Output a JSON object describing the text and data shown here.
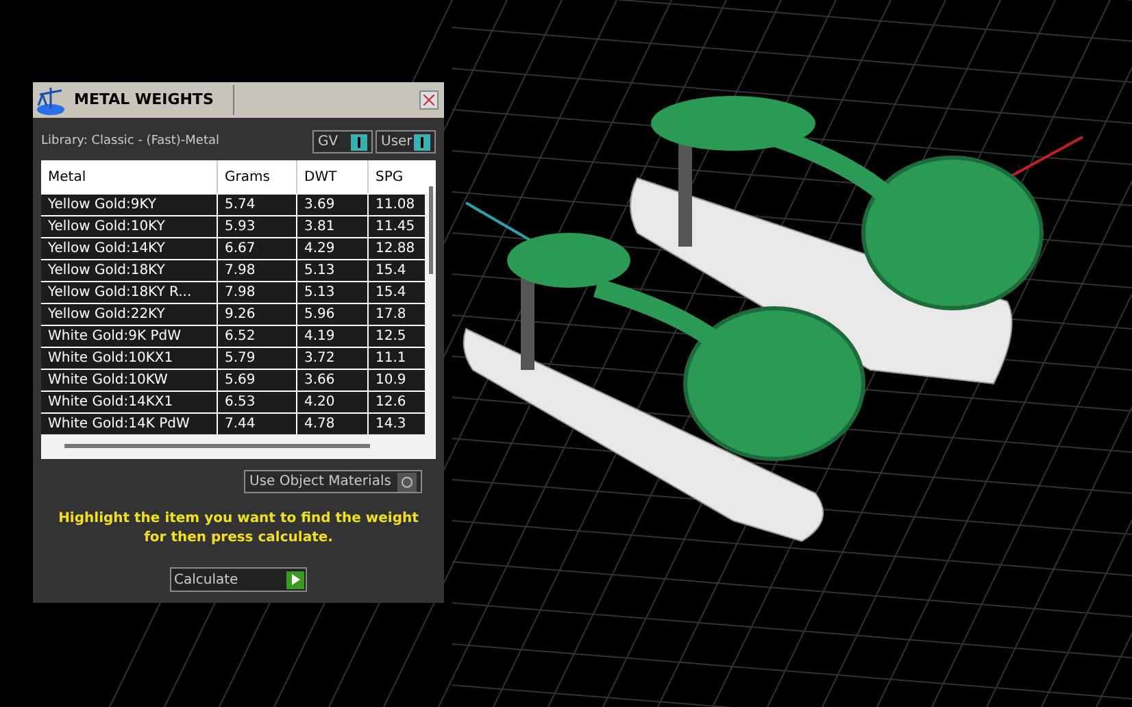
{
  "panel": {
    "title": "METAL WEIGHTS",
    "library": "Library: Classic - (Fast)-Metal",
    "toggles": [
      {
        "label": "GV",
        "on": true
      },
      {
        "label": "User",
        "on": true
      }
    ],
    "table": {
      "columns": [
        "Metal",
        "Grams",
        "DWT",
        "SPG"
      ],
      "rows": [
        {
          "cells": [
            "Yellow Gold:9KY",
            "5.74",
            "3.69",
            "11.08"
          ],
          "selected": false
        },
        {
          "cells": [
            "Yellow Gold:10KY",
            "5.93",
            "3.81",
            "11.45"
          ],
          "selected": false
        },
        {
          "cells": [
            "Yellow Gold:14KY",
            "6.67",
            "4.29",
            "12.88"
          ],
          "selected": false
        },
        {
          "cells": [
            "Yellow Gold:18KY",
            "7.98",
            "5.13",
            "15.4"
          ],
          "selected": false
        },
        {
          "cells": [
            "Yellow Gold:18KY R...",
            "7.98",
            "5.13",
            "15.4"
          ],
          "selected": false
        },
        {
          "cells": [
            "Yellow Gold:22KY",
            "9.26",
            "5.96",
            "17.8"
          ],
          "selected": false
        },
        {
          "cells": [
            "White Gold:9K PdW",
            "6.52",
            "4.19",
            "12.5"
          ],
          "selected": false
        },
        {
          "cells": [
            "White Gold:10KX1",
            "5.79",
            "3.72",
            "11.1"
          ],
          "selected": false
        },
        {
          "cells": [
            "White Gold:10KW",
            "5.69",
            "3.66",
            "10.9"
          ],
          "selected": false
        },
        {
          "cells": [
            "White Gold:14KX1",
            "6.53",
            "4.20",
            "12.6"
          ],
          "selected": false
        },
        {
          "cells": [
            "White Gold:14K PdW",
            "7.44",
            "4.78",
            "14.3"
          ],
          "selected": false
        }
      ]
    },
    "use_object_materials": {
      "label": "Use Object Materials",
      "on": false
    },
    "hint": "Highlight the item you want to find the weight for then press calculate.",
    "calculate_button": "Calculate"
  }
}
